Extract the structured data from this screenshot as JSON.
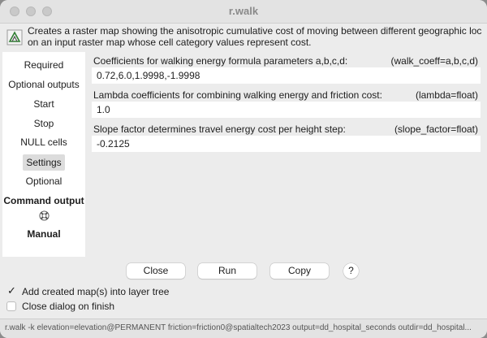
{
  "window": {
    "title": "r.walk"
  },
  "description": {
    "line1": "Creates a raster map showing the anisotropic cumulative cost of moving between different geographic locatio",
    "line2": "on an input raster map whose cell category values represent cost."
  },
  "sidebar": {
    "items": [
      {
        "label": "Required"
      },
      {
        "label": "Optional outputs"
      },
      {
        "label": "Start"
      },
      {
        "label": "Stop"
      },
      {
        "label": "NULL cells"
      },
      {
        "label": "Settings"
      },
      {
        "label": "Optional"
      },
      {
        "label": "Command output"
      },
      {
        "label": "Manual"
      }
    ],
    "selected": "Settings"
  },
  "parameters": [
    {
      "label": "Coefficients for walking energy formula parameters a,b,c,d:",
      "key": "(walk_coeff=a,b,c,d)",
      "value": "0.72,6.0,1.9998,-1.9998"
    },
    {
      "label": "Lambda coefficients for combining walking energy and friction cost:",
      "key": "(lambda=float)",
      "value": "1.0"
    },
    {
      "label": "Slope factor determines travel energy cost per height step:",
      "key": "(slope_factor=float)",
      "value": "-0.2125"
    }
  ],
  "buttons": {
    "close": "Close",
    "run": "Run",
    "copy": "Copy",
    "help": "?"
  },
  "options": [
    {
      "label": "Add created map(s) into layer tree",
      "checked": true
    },
    {
      "label": "Close dialog on finish",
      "checked": false
    }
  ],
  "statusbar": "r.walk -k elevation=elevation@PERMANENT friction=friction0@spatialtech2023 output=dd_hospital_seconds outdir=dd_hospital...",
  "icons": {
    "window_icon": "grass-module-icon",
    "help_icon": "lifebuoy-icon"
  }
}
